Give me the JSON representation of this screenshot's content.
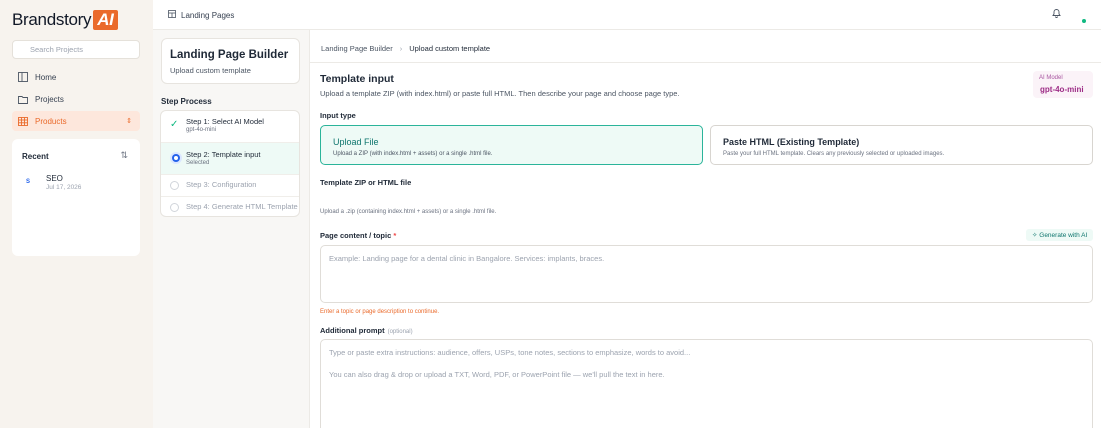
{
  "brand": {
    "name": "Brandstory",
    "ai": "AI"
  },
  "sidebar": {
    "search_placeholder": "Search Projects",
    "items": [
      {
        "label": "Home"
      },
      {
        "label": "Projects"
      },
      {
        "label": "Products"
      }
    ],
    "recent": {
      "title": "Recent",
      "items": [
        {
          "name": "SEO",
          "date": "Jul 17, 2026"
        }
      ]
    }
  },
  "topbar": {
    "page": "Landing Pages"
  },
  "builder": {
    "title": "Landing Page Builder",
    "subtitle": "Upload custom template"
  },
  "steps": {
    "title": "Step Process",
    "items": [
      {
        "label": "Step 1: Select AI Model",
        "sub": "gpt-4o-mini"
      },
      {
        "label": "Step 2: Template input",
        "sub": "Selected"
      },
      {
        "label": "Step 3: Configuration"
      },
      {
        "label": "Step 4: Generate HTML Template"
      }
    ]
  },
  "main": {
    "breadcrumb": {
      "parent": "Landing Page Builder",
      "current": "Upload custom template"
    },
    "title": "Template input",
    "description": "Upload a template ZIP (with index.html) or paste full HTML. Then describe your page and choose page type.",
    "model": {
      "label": "AI Model",
      "value": "gpt-4o-mini"
    },
    "input_type_label": "Input type",
    "options": [
      {
        "title": "Upload File",
        "desc": "Upload a ZIP (with index.html + assets) or a single .html file."
      },
      {
        "title": "Paste HTML (Existing Template)",
        "desc": "Paste your full HTML template. Clears any previously selected or uploaded images."
      }
    ],
    "file_label": "Template ZIP or HTML file",
    "file_hint": "Upload a .zip (containing index.html + assets) or a single .html file.",
    "topic_label": "Page content / topic",
    "required_mark": "*",
    "generate_button": "Generate with AI",
    "topic_placeholder": "Example: Landing page for a dental clinic in Bangalore. Services: implants, braces.",
    "topic_warning": "Enter a topic or page description to continue.",
    "prompt_label": "Additional prompt",
    "prompt_optional": "(optional)",
    "prompt_placeholder_1": "Type or paste extra instructions: audience, offers, USPs, tone notes, sections to emphasize, words to avoid...",
    "prompt_placeholder_2": "You can also drag & drop or upload a TXT, Word, PDF, or PowerPoint file — we'll pull the text in here."
  }
}
